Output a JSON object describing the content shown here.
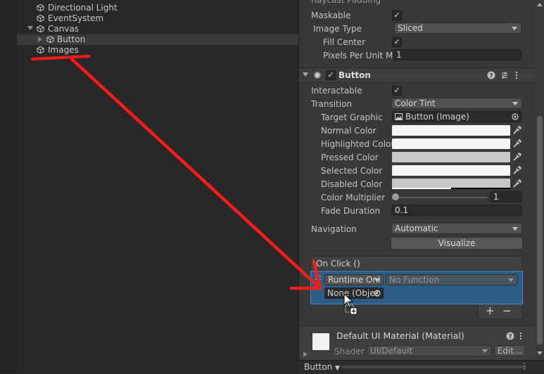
{
  "hierarchy": {
    "items": [
      {
        "label": "Directional Light"
      },
      {
        "label": "EventSystem"
      },
      {
        "label": "Canvas"
      },
      {
        "label": "Button"
      },
      {
        "label": "Images"
      }
    ]
  },
  "inspector": {
    "image": {
      "raycast_padding": "Raycast Padding",
      "maskable_label": "Maskable",
      "image_type_label": "Image Type",
      "image_type_value": "Sliced",
      "fill_center_label": "Fill Center",
      "ppu_label": "Pixels Per Unit Mul",
      "ppu_value": "1"
    },
    "button": {
      "title": "Button",
      "interactable_label": "Interactable",
      "transition_label": "Transition",
      "transition_value": "Color Tint",
      "target_graphic_label": "Target Graphic",
      "target_graphic_value": "Button (Image)",
      "normal_color_label": "Normal Color",
      "highlighted_color_label": "Highlighted Color",
      "pressed_color_label": "Pressed Color",
      "selected_color_label": "Selected Color",
      "disabled_color_label": "Disabled Color",
      "color_multiplier_label": "Color Multiplier",
      "color_multiplier_value": "1",
      "fade_duration_label": "Fade Duration",
      "fade_duration_value": "0.1",
      "navigation_label": "Navigation",
      "navigation_value": "Automatic",
      "visualize_label": "Visualize",
      "onclick_label": "On Click ()",
      "runtime_value": "Runtime Onl",
      "function_value": "No Function",
      "object_value": "None (Objec",
      "add_label": "+",
      "remove_label": "−"
    },
    "material": {
      "title": "Default UI Material (Material)",
      "shader_label": "Shader",
      "shader_value": "UI/Default",
      "edit_label": "Edit..."
    },
    "footer": {
      "object_label": "Button"
    }
  },
  "colors": {
    "normal": "#f5f5f5",
    "highlighted": "#f5f5f5",
    "pressed": "#c8c8c8",
    "selected": "#f5f5f5",
    "disabled": "#c8c8c8",
    "onclick_highlight": "#2c5d87",
    "annotation": "#ff1a1a"
  }
}
